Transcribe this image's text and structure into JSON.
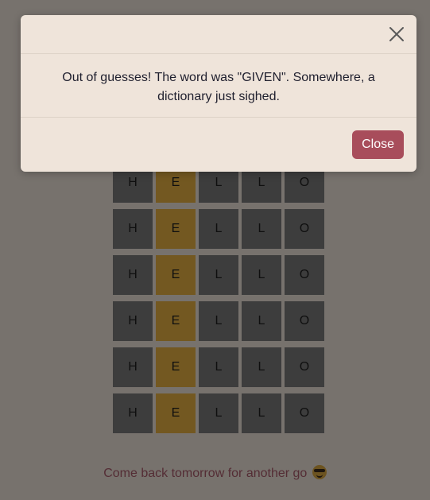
{
  "board": {
    "rows": [
      [
        "H",
        "E",
        "L",
        "L",
        "O"
      ],
      [
        "H",
        "E",
        "L",
        "L",
        "O"
      ],
      [
        "H",
        "E",
        "L",
        "L",
        "O"
      ],
      [
        "H",
        "E",
        "L",
        "L",
        "O"
      ],
      [
        "H",
        "E",
        "L",
        "L",
        "O"
      ],
      [
        "H",
        "E",
        "L",
        "L",
        "O"
      ]
    ],
    "states": [
      [
        "absent",
        "present",
        "absent",
        "absent",
        "absent"
      ],
      [
        "absent",
        "present",
        "absent",
        "absent",
        "absent"
      ],
      [
        "absent",
        "present",
        "absent",
        "absent",
        "absent"
      ],
      [
        "absent",
        "present",
        "absent",
        "absent",
        "absent"
      ],
      [
        "absent",
        "present",
        "absent",
        "absent",
        "absent"
      ],
      [
        "absent",
        "present",
        "absent",
        "absent",
        "absent"
      ]
    ]
  },
  "footer": {
    "message": "Come back tomorrow for another go",
    "emoji_icon": "smiling-face-with-sunglasses-icon"
  },
  "modal": {
    "message": "Out of guesses! The word was \"GIVEN\". Somewhere, a dictionary just sighed.",
    "close_label": "Close",
    "close_icon": "close-icon"
  },
  "colors": {
    "absent": "#7a7a7a",
    "present": "#e7b143",
    "button": "#a84d5b",
    "background": "#efe4da"
  }
}
